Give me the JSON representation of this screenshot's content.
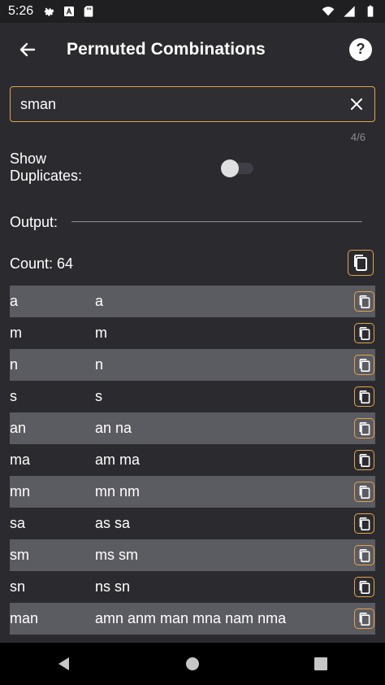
{
  "status_bar": {
    "time": "5:26",
    "icons": [
      "gear-icon",
      "text-box-icon",
      "sd-card-icon",
      "wifi-icon",
      "signal-icon",
      "battery-icon"
    ]
  },
  "app_bar": {
    "title": "Permuted Combinations",
    "back_icon": "arrow-left-icon",
    "help_icon": "help-icon",
    "help_glyph": "?"
  },
  "search": {
    "value": "sman",
    "placeholder": "",
    "clear_icon": "close-icon",
    "counter": "4/6"
  },
  "options": {
    "show_duplicates_label": "Show\nDuplicates:",
    "show_duplicates_on": false
  },
  "output": {
    "label": "Output:",
    "count_label": "Count: 64"
  },
  "rows": [
    {
      "key": "a",
      "value": "a"
    },
    {
      "key": "m",
      "value": "m"
    },
    {
      "key": "n",
      "value": "n"
    },
    {
      "key": "s",
      "value": "s"
    },
    {
      "key": "an",
      "value": "an na"
    },
    {
      "key": "ma",
      "value": "am ma"
    },
    {
      "key": "mn",
      "value": "mn nm"
    },
    {
      "key": "sa",
      "value": "as sa"
    },
    {
      "key": "sm",
      "value": "ms sm"
    },
    {
      "key": "sn",
      "value": "ns sn"
    },
    {
      "key": "man",
      "value": "amn anm man mna nam nma"
    }
  ],
  "colors": {
    "background": "#2b2b2f",
    "accent": "#e3a34b",
    "row_alt": "#5b5b62",
    "nav_bar": "#000000"
  },
  "nav_bar": {
    "back_icon": "nav-back-icon",
    "home_icon": "nav-home-icon",
    "recents_icon": "nav-recents-icon"
  }
}
